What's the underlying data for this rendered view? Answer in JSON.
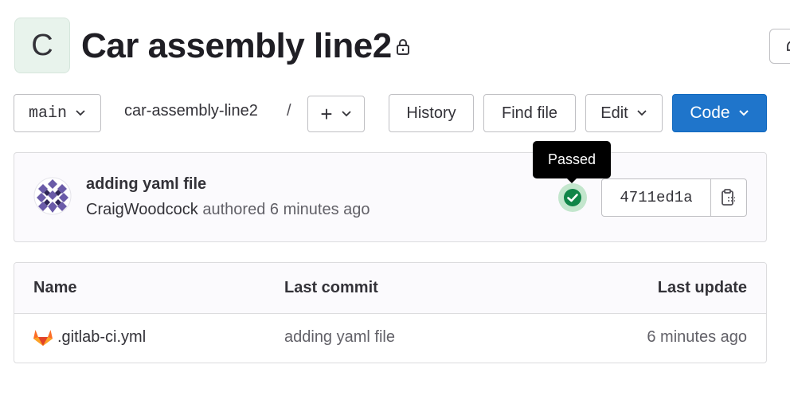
{
  "project": {
    "avatar_letter": "C",
    "title": "Car assembly line2",
    "visibility_icon": "lock-icon"
  },
  "toolbar": {
    "branch": "main",
    "breadcrumb_project": "car-assembly-line2",
    "breadcrumb_separator": "/",
    "add_label": "+",
    "history_label": "History",
    "find_file_label": "Find file",
    "edit_label": "Edit",
    "code_label": "Code"
  },
  "commit": {
    "title": "adding yaml file",
    "author": "CraigWoodcock",
    "authored_text": "authored 6 minutes ago",
    "pipeline_status": "Passed",
    "sha": "4711ed1a"
  },
  "file_table": {
    "columns": [
      "Name",
      "Last commit",
      "Last update"
    ],
    "rows": [
      {
        "name": ".gitlab-ci.yml",
        "last_commit": "adding yaml file",
        "last_update": "6 minutes ago"
      }
    ]
  },
  "colors": {
    "primary": "#1f75cb",
    "success": "#108548",
    "gitlab_orange": "#e24329"
  }
}
